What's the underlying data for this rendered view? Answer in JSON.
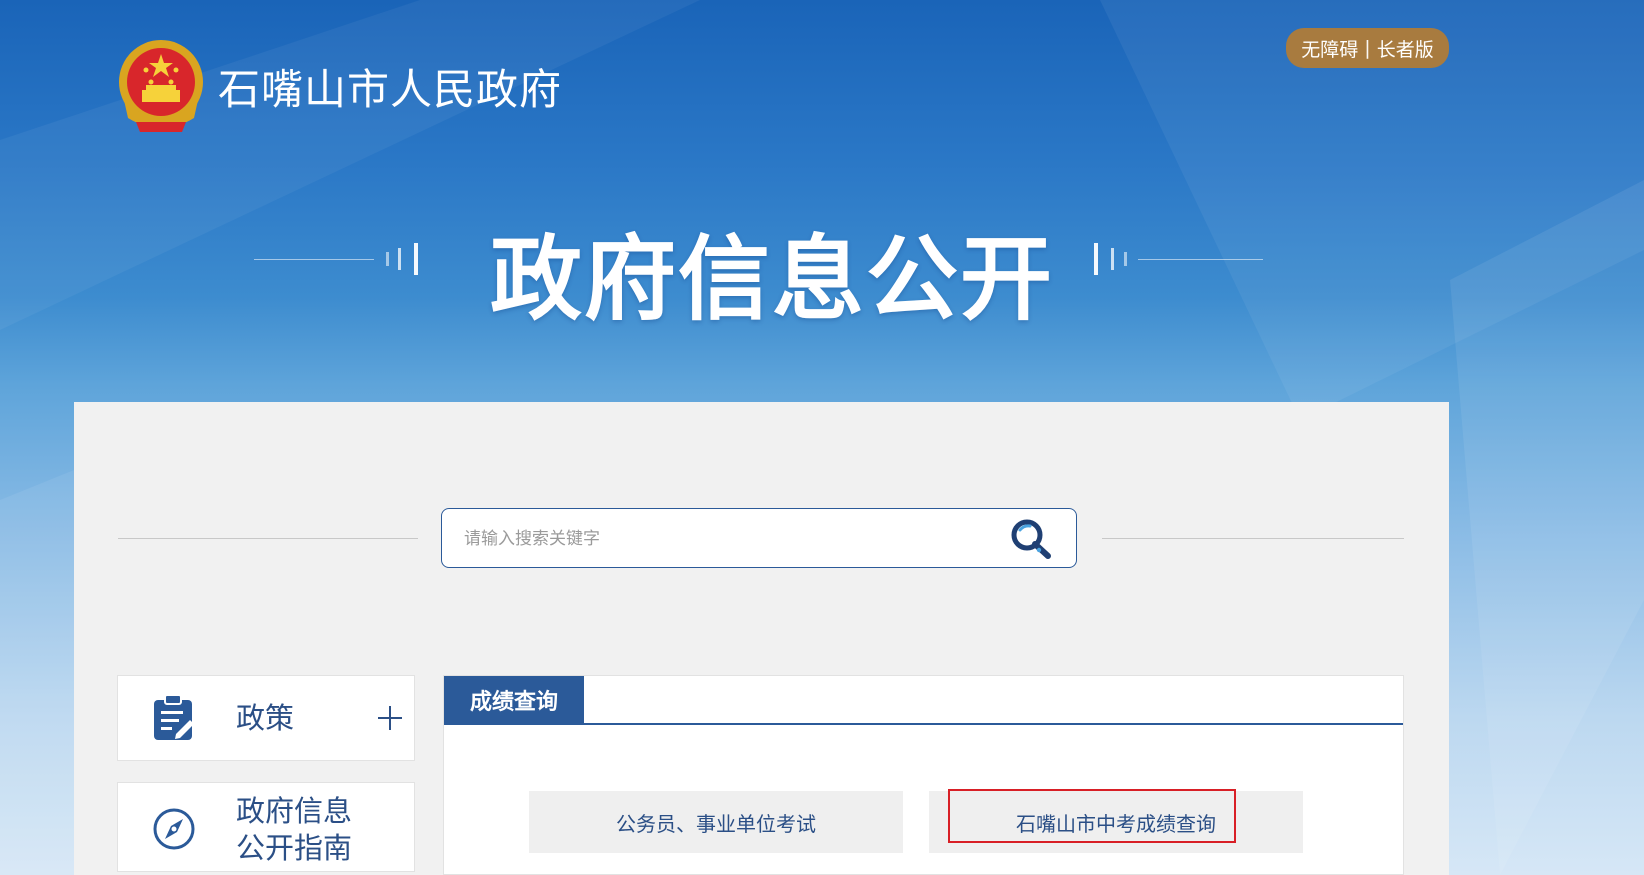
{
  "header": {
    "site_title": "石嘴山市人民政府",
    "accessibility_label": "无障碍",
    "separator": "|",
    "elder_label": "长者版",
    "hero_title": "政府信息公开"
  },
  "search": {
    "placeholder": "请输入搜索关键字",
    "value": ""
  },
  "sidebar": {
    "items": [
      {
        "label": "政策",
        "icon": "document-edit-icon",
        "expand": "plus-icon"
      },
      {
        "label": "政府信息\n公开指南",
        "icon": "compass-icon"
      }
    ]
  },
  "panel": {
    "tab_label": "成绩查询",
    "links": [
      {
        "label": "公务员、事业单位考试"
      },
      {
        "label": "石嘴山市中考成绩查询",
        "highlighted": true
      }
    ]
  },
  "colors": {
    "primary_blue": "#2b5a99",
    "accent_gold": "#a87b3f",
    "highlight_red": "#d81f26",
    "content_bg": "#f1f1f1"
  }
}
